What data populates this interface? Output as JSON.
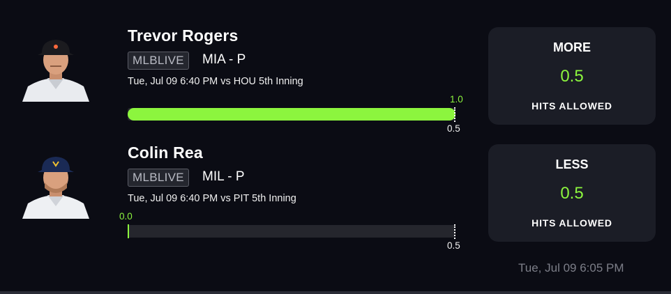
{
  "players": [
    {
      "name": "Trevor Rogers",
      "badge": "MLBLIVE",
      "team_pos": "MIA - P",
      "game_info": "Tue, Jul 09 6:40 PM  vs HOU 5th Inning",
      "current_value": "1.0",
      "current_fraction": 1.0,
      "line": "0.5",
      "cap_color": "#1b1b1f",
      "accent": "#8cf53e"
    },
    {
      "name": "Colin Rea",
      "badge": "MLBLIVE",
      "team_pos": "MIL - P",
      "game_info": "Tue, Jul 09 6:40 PM  vs PIT 5th Inning",
      "current_value": "0.0",
      "current_fraction": 0.0,
      "line": "0.5",
      "cap_color": "#1a2a55",
      "accent": "#8cf53e"
    }
  ],
  "picks": [
    {
      "direction": "MORE",
      "value": "0.5",
      "stat": "HITS ALLOWED"
    },
    {
      "direction": "LESS",
      "value": "0.5",
      "stat": "HITS ALLOWED"
    }
  ],
  "timestamp": "Tue, Jul 09 6:05 PM"
}
